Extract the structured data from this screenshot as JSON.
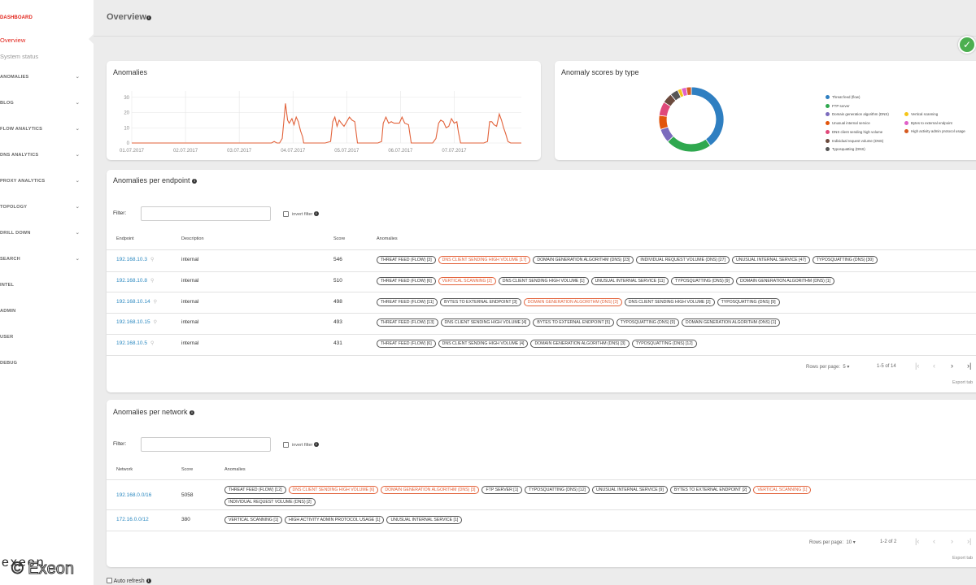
{
  "sidebar": {
    "section": "DASHBOARD",
    "sub_items": [
      "Overview",
      "System status"
    ],
    "items": [
      "ANOMALIES",
      "BLOG",
      "FLOW ANALYTICS",
      "DNS ANALYTICS",
      "PROXY ANALYTICS",
      "TOPOLOGY",
      "DRILL DOWN",
      "SEARCH",
      "INTEL",
      "ADMIN",
      "USER",
      "DEBUG"
    ],
    "logo_text": "exeon",
    "watermark": "© Exeon"
  },
  "header": {
    "title": "Overview"
  },
  "anomalies_chart": {
    "title": "Anomalies",
    "chart_data": {
      "type": "line",
      "title": "Anomalies",
      "x_ticks": [
        "01.07.2017",
        "02.07.2017",
        "03.07.2017",
        "04.07.2017",
        "05.07.2017",
        "06.07.2017",
        "07.07.2017"
      ],
      "y_ticks": [
        0,
        10,
        20,
        30
      ],
      "ylim": [
        0,
        32
      ],
      "xlim_days": [
        0,
        7.25
      ],
      "series": [
        {
          "color": "#e2623a",
          "points": [
            [
              0,
              0
            ],
            [
              2.6,
              0
            ],
            [
              2.65,
              1
            ],
            [
              2.7,
              0
            ],
            [
              2.75,
              0
            ],
            [
              2.8,
              3
            ],
            [
              2.86,
              26
            ],
            [
              2.9,
              15
            ],
            [
              2.93,
              13
            ],
            [
              2.98,
              16
            ],
            [
              3.02,
              12
            ],
            [
              3.06,
              17
            ],
            [
              3.1,
              14
            ],
            [
              3.14,
              8
            ],
            [
              3.18,
              4
            ],
            [
              3.2,
              0
            ],
            [
              3.6,
              0
            ],
            [
              3.7,
              1
            ],
            [
              3.74,
              14
            ],
            [
              3.78,
              17
            ],
            [
              3.82,
              11
            ],
            [
              3.86,
              15
            ],
            [
              3.9,
              13
            ],
            [
              3.95,
              11
            ],
            [
              4.0,
              14
            ],
            [
              4.05,
              17
            ],
            [
              4.1,
              15
            ],
            [
              4.15,
              14
            ],
            [
              4.2,
              0
            ],
            [
              4.58,
              0
            ],
            [
              4.65,
              1
            ],
            [
              4.68,
              13
            ],
            [
              4.73,
              17
            ],
            [
              4.78,
              13
            ],
            [
              4.83,
              14
            ],
            [
              4.88,
              13
            ],
            [
              4.93,
              13
            ],
            [
              4.98,
              13
            ],
            [
              5.03,
              17
            ],
            [
              5.08,
              13
            ],
            [
              5.15,
              12
            ],
            [
              5.2,
              0
            ],
            [
              5.6,
              0
            ],
            [
              5.66,
              3
            ],
            [
              5.71,
              13
            ],
            [
              5.75,
              15
            ],
            [
              5.8,
              14
            ],
            [
              5.85,
              10
            ],
            [
              5.9,
              11
            ],
            [
              5.95,
              16
            ],
            [
              6.0,
              13
            ],
            [
              6.05,
              14
            ],
            [
              6.08,
              7
            ],
            [
              6.12,
              0
            ],
            [
              6.55,
              0
            ],
            [
              6.62,
              1
            ],
            [
              6.66,
              14
            ],
            [
              6.7,
              14
            ],
            [
              6.74,
              12
            ],
            [
              6.79,
              11
            ],
            [
              6.84,
              19
            ],
            [
              6.88,
              15
            ],
            [
              6.92,
              10
            ],
            [
              6.96,
              6
            ],
            [
              7.0,
              1
            ],
            [
              7.05,
              0
            ],
            [
              7.25,
              0
            ]
          ]
        }
      ]
    }
  },
  "scores": {
    "title": "Anomaly scores by type",
    "chart_data": {
      "type": "pie",
      "title": "Anomaly scores by type",
      "slices": [
        {
          "label": "Threat feed (flow)",
          "value": 40,
          "color": "#2f7fc1"
        },
        {
          "label": "FTP server",
          "value": 23,
          "color": "#2fa84f"
        },
        {
          "label": "Domain generation algorithm (DNS)",
          "value": 7,
          "color": "#7b6bbd"
        },
        {
          "label": "Unusual internal service",
          "value": 7,
          "color": "#e2550c"
        },
        {
          "label": "DNS client sending high volume",
          "value": 7,
          "color": "#e0497a"
        },
        {
          "label": "Individual request volume (DNS)",
          "value": 5,
          "color": "#6b4a3d"
        },
        {
          "label": "Typosquatting (DNS)",
          "value": 4,
          "color": "#555555"
        },
        {
          "label": "Vertical scanning",
          "value": 2,
          "color": "#f5c518"
        },
        {
          "label": "Bytes to external endpoint",
          "value": 2.5,
          "color": "#e060c8"
        },
        {
          "label": "High activity admin protocol usage",
          "value": 2.5,
          "color": "#d65a20"
        }
      ]
    },
    "legend_left": [
      "Threat feed (flow)",
      "FTP server",
      "Domain generation algorithm (DNS)",
      "Unusual internal service",
      "DNS client sending high volume",
      "Individual request volume (DNS)",
      "Typosquatting (DNS)"
    ],
    "legend_right": [
      "Vertical scanning",
      "Bytes to external endpoint",
      "High activity admin protocol usage"
    ],
    "colors_left": [
      "#2f7fc1",
      "#2fa84f",
      "#7b6bbd",
      "#e2550c",
      "#e0497a",
      "#6b4a3d",
      "#555555"
    ],
    "colors_right": [
      "#f5c518",
      "#e060c8",
      "#d65a20"
    ]
  },
  "endpoint": {
    "title": "Anomalies per endpoint",
    "filter_label": "Filter:",
    "invert_label": "invert filter",
    "headers": [
      "Endpoint",
      "Description",
      "Score",
      "Anomalies"
    ],
    "rows": [
      {
        "ep": "192.168.10.3",
        "desc": "internal",
        "score": "546",
        "tags": [
          {
            "t": "THREAT FEED (FLOW) [3]"
          },
          {
            "t": "DNS CLIENT SENDING HIGH VOLUME [17]",
            "hl": true
          },
          {
            "t": "DOMAIN GENERATION ALGORITHM (DNS) [23]"
          },
          {
            "t": "INDIVIDUAL REQUEST VOLUME (DNS) [27]"
          },
          {
            "t": "UNUSUAL INTERNAL SERVICE [47]"
          },
          {
            "t": "TYPOSQUATTING (DNS) [30]"
          }
        ]
      },
      {
        "ep": "192.168.10.8",
        "desc": "internal",
        "score": "510",
        "tags": [
          {
            "t": "THREAT FEED (FLOW) [6]"
          },
          {
            "t": "VERTICAL SCANNING [2]",
            "hl": true
          },
          {
            "t": "DNS CLIENT SENDING HIGH VOLUME [1]"
          },
          {
            "t": "UNUSUAL INTERNAL SERVICE [11]"
          },
          {
            "t": "TYPOSQUATTING (DNS) [9]"
          },
          {
            "t": "DOMAIN GENERATION ALGORITHM (DNS) [1]"
          }
        ]
      },
      {
        "ep": "192.168.10.14",
        "desc": "internal",
        "score": "498",
        "tags": [
          {
            "t": "THREAT FEED (FLOW) [11]"
          },
          {
            "t": "BYTES TO EXTERNAL ENDPOINT [3]"
          },
          {
            "t": "DOMAIN GENERATION ALGORITHM (DNS) [3]",
            "hl": true
          },
          {
            "t": "DNS CLIENT SENDING HIGH VOLUME [2]"
          },
          {
            "t": "TYPOSQUATTING (DNS) [9]"
          }
        ]
      },
      {
        "ep": "192.168.10.15",
        "desc": "internal",
        "score": "493",
        "tags": [
          {
            "t": "THREAT FEED (FLOW) [13]"
          },
          {
            "t": "DNS CLIENT SENDING HIGH VOLUME [4]"
          },
          {
            "t": "BYTES TO EXTERNAL ENDPOINT [5]"
          },
          {
            "t": "TYPOSQUATTING (DNS) [9]"
          },
          {
            "t": "DOMAIN GENERATION ALGORITHM (DNS) [1]"
          }
        ]
      },
      {
        "ep": "192.168.10.5",
        "desc": "internal",
        "score": "431",
        "tags": [
          {
            "t": "THREAT FEED (FLOW) [6]"
          },
          {
            "t": "DNS CLIENT SENDING HIGH VOLUME [4]"
          },
          {
            "t": "DOMAIN GENERATION ALGORITHM (DNS) [3]"
          },
          {
            "t": "TYPOSQUATTING (DNS) [12]"
          }
        ]
      }
    ],
    "rows_per_page_label": "Rows per page:",
    "rows_per_page": "5",
    "range": "1-5 of 14",
    "export": "Export tab"
  },
  "network": {
    "title": "Anomalies per network",
    "filter_label": "Filter:",
    "invert_label": "invert filter",
    "headers": [
      "Network",
      "Score",
      "Anomalies"
    ],
    "rows": [
      {
        "net": "192.168.0.0/16",
        "score": "5058",
        "tags1": [
          {
            "t": "THREAT FEED (FLOW) [12]"
          },
          {
            "t": "DNS CLIENT SENDING HIGH VOLUME [6]",
            "hl": true
          },
          {
            "t": "DOMAIN GENERATION ALGORITHM (DNS) [3]",
            "hl": true
          },
          {
            "t": "FTP SERVER [1]"
          },
          {
            "t": "TYPOSQUATTING (DNS) [12]"
          },
          {
            "t": "UNUSUAL INTERNAL SERVICE [9]"
          },
          {
            "t": "BYTES TO EXTERNAL ENDPOINT [2]"
          },
          {
            "t": "VERTICAL SCANNING [1]",
            "hl": true
          }
        ],
        "tags2": [
          {
            "t": "INDIVIDUAL REQUEST VOLUME (DNS) [2]"
          }
        ]
      },
      {
        "net": "172.16.0.0/12",
        "score": "380",
        "tags1": [
          {
            "t": "VERTICAL SCANNING [1]"
          },
          {
            "t": "HIGH ACTIVITY ADMIN PROTOCOL USAGE [1]"
          },
          {
            "t": "UNUSUAL INTERNAL SERVICE [1]"
          }
        ],
        "tags2": []
      }
    ],
    "rows_per_page_label": "Rows per page:",
    "rows_per_page": "10",
    "range": "1-2 of 2",
    "export": "Export tab"
  },
  "auto_refresh_label": "Auto refresh"
}
